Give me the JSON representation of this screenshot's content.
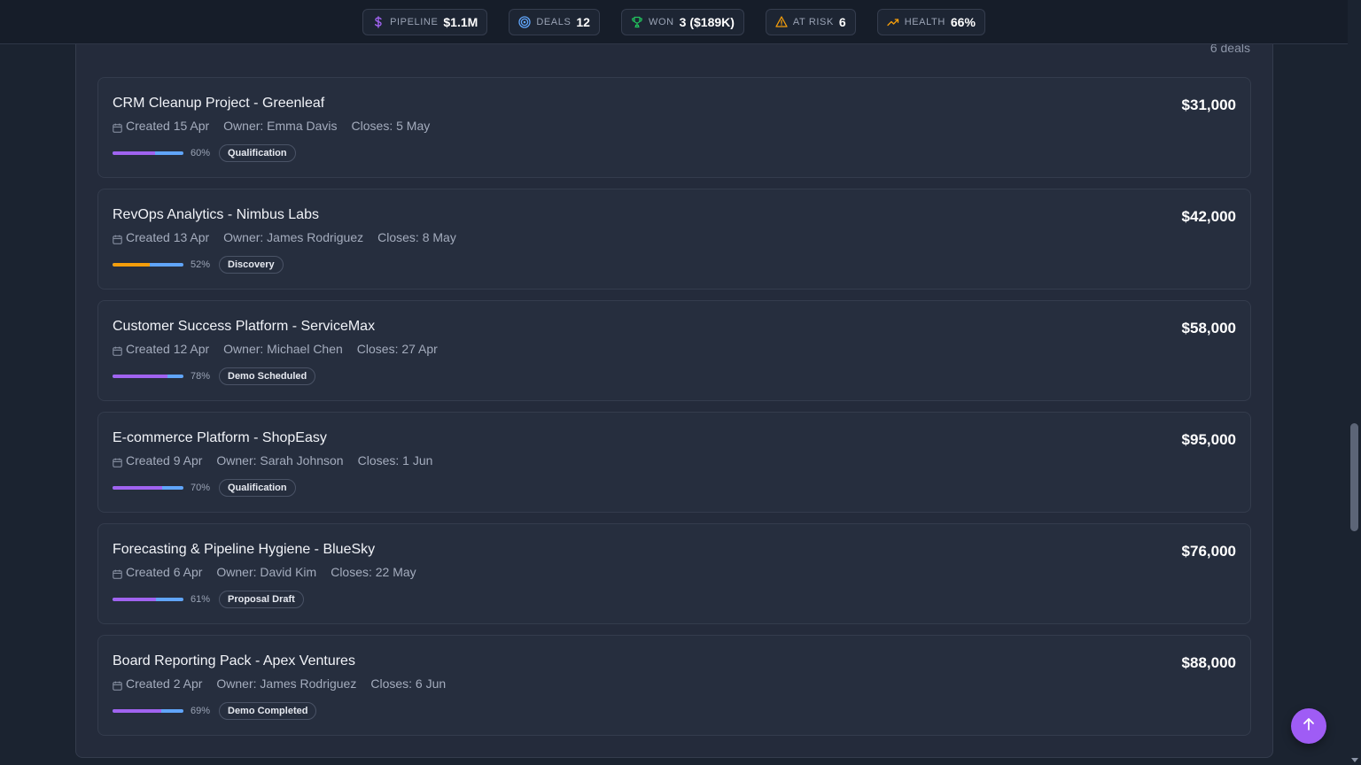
{
  "stats": [
    {
      "icon": "dollar-icon",
      "label": "PIPELINE",
      "value": "$1.1M",
      "color": "#a063f0"
    },
    {
      "icon": "target-icon",
      "label": "DEALS",
      "value": "12",
      "color": "#60a5fa"
    },
    {
      "icon": "trophy-icon",
      "label": "WON",
      "value": "3 ($189K)",
      "color": "#22c55e"
    },
    {
      "icon": "warning-icon",
      "label": "AT RISK",
      "value": "6",
      "color": "#f59e0b"
    },
    {
      "icon": "trending-up-icon",
      "label": "HEALTH",
      "value": "66%",
      "color": "#f59e0b"
    }
  ],
  "panel": {
    "deal_count": "6 deals"
  },
  "deals": [
    {
      "title": "CRM Cleanup Project - Greenleaf",
      "amount": "$31,000",
      "created": "Created 15 Apr",
      "owner": "Owner: Emma Davis",
      "closes": "Closes: 5 May",
      "progress": 0.6,
      "progress_label": "60%",
      "stage": "Qualification",
      "bar_color": "purple"
    },
    {
      "title": "RevOps Analytics - Nimbus Labs",
      "amount": "$42,000",
      "created": "Created 13 Apr",
      "owner": "Owner: James Rodriguez",
      "closes": "Closes: 8 May",
      "progress": 0.52,
      "progress_label": "52%",
      "stage": "Discovery",
      "bar_color": "orange"
    },
    {
      "title": "Customer Success Platform - ServiceMax",
      "amount": "$58,000",
      "created": "Created 12 Apr",
      "owner": "Owner: Michael Chen",
      "closes": "Closes: 27 Apr",
      "progress": 0.78,
      "progress_label": "78%",
      "stage": "Demo Scheduled",
      "bar_color": "purple"
    },
    {
      "title": "E-commerce Platform - ShopEasy",
      "amount": "$95,000",
      "created": "Created 9 Apr",
      "owner": "Owner: Sarah Johnson",
      "closes": "Closes: 1 Jun",
      "progress": 0.7,
      "progress_label": "70%",
      "stage": "Qualification",
      "bar_color": "purple"
    },
    {
      "title": "Forecasting & Pipeline Hygiene - BlueSky",
      "amount": "$76,000",
      "created": "Created 6 Apr",
      "owner": "Owner: David Kim",
      "closes": "Closes: 22 May",
      "progress": 0.61,
      "progress_label": "61%",
      "stage": "Proposal Draft",
      "bar_color": "purple"
    },
    {
      "title": "Board Reporting Pack - Apex Ventures",
      "amount": "$88,000",
      "created": "Created 2 Apr",
      "owner": "Owner: James Rodriguez",
      "closes": "Closes: 6 Jun",
      "progress": 0.69,
      "progress_label": "69%",
      "stage": "Demo Completed",
      "bar_color": "purple"
    }
  ],
  "back_to_top": {
    "icon": "arrow-up-icon"
  }
}
